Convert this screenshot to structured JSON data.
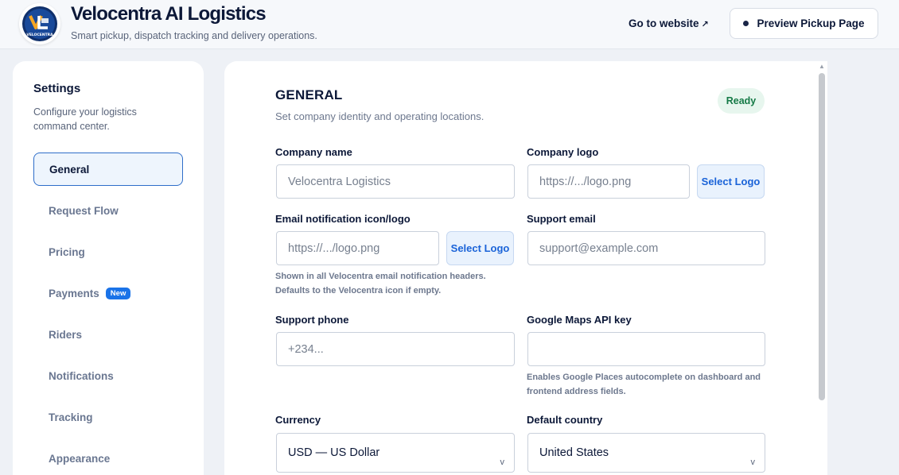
{
  "header": {
    "brand_title": "Velocentra AI Logistics",
    "brand_subtitle": "Smart pickup, dispatch tracking and delivery operations.",
    "logo_text": "VELOCENTRA",
    "go_to_website": "Go to website",
    "preview_button": "Preview Pickup Page"
  },
  "sidebar": {
    "title": "Settings",
    "subtitle": "Configure your logistics command center.",
    "items": [
      {
        "label": "General",
        "active": true
      },
      {
        "label": "Request Flow"
      },
      {
        "label": "Pricing"
      },
      {
        "label": "Payments",
        "badge": "New"
      },
      {
        "label": "Riders"
      },
      {
        "label": "Notifications"
      },
      {
        "label": "Tracking"
      },
      {
        "label": "Appearance"
      }
    ]
  },
  "main": {
    "section_title": "GENERAL",
    "section_subtitle": "Set company identity and operating locations.",
    "status_badge": "Ready",
    "fields": {
      "company_name": {
        "label": "Company name",
        "placeholder": "Velocentra Logistics"
      },
      "company_logo": {
        "label": "Company logo",
        "placeholder": "https://.../logo.png",
        "button": "Select Logo"
      },
      "email_icon": {
        "label": "Email notification icon/logo",
        "placeholder": "https://.../logo.png",
        "button": "Select Logo",
        "hint": "Shown in all Velocentra email notification headers. Defaults to the Velocentra icon if empty."
      },
      "support_email": {
        "label": "Support email",
        "placeholder": "support@example.com"
      },
      "support_phone": {
        "label": "Support phone",
        "placeholder": "+234..."
      },
      "google_maps": {
        "label": "Google Maps API key",
        "placeholder": "",
        "hint": "Enables Google Places autocomplete on dashboard and frontend address fields."
      },
      "currency": {
        "label": "Currency",
        "value": "USD — US Dollar"
      },
      "default_country": {
        "label": "Default country",
        "value": "United States"
      }
    }
  },
  "colors": {
    "accent": "#1a73e8",
    "ready_bg": "#e7f6ee",
    "ready_text": "#157a46",
    "brand_navy": "#0c1838"
  }
}
